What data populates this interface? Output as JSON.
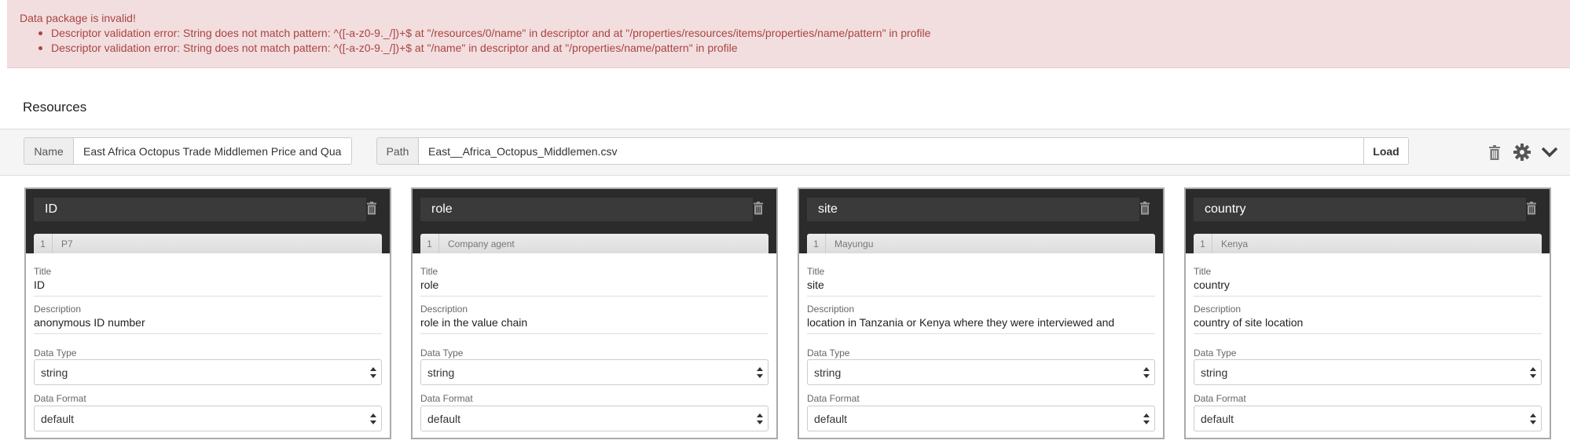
{
  "alert": {
    "title": "Data package is invalid!",
    "errors": [
      "Descriptor validation error: String does not match pattern: ^([-a-z0-9._/])+$ at \"/resources/0/name\" in descriptor and at \"/properties/resources/items/properties/name/pattern\" in profile",
      "Descriptor validation error: String does not match pattern: ^([-a-z0-9._/])+$ at \"/name\" in descriptor and at \"/properties/name/pattern\" in profile"
    ],
    "colors": {
      "background": "#f2dede",
      "text": "#a94442"
    }
  },
  "section_title": "Resources",
  "resource": {
    "name_label": "Name",
    "name_value": "East Africa Octopus Trade Middlemen Price and Qua",
    "path_label": "Path",
    "path_value": "East__Africa_Octopus_Middlemen.csv",
    "load_label": "Load",
    "icons": [
      "trash-icon",
      "gear-icon",
      "chevron-down-icon"
    ]
  },
  "labels": {
    "title": "Title",
    "description": "Description",
    "data_type": "Data Type",
    "data_format": "Data Format"
  },
  "fields": [
    {
      "name": "ID",
      "preview_row": "1",
      "preview_value": "P7",
      "title": "ID",
      "description": "anonymous ID number",
      "data_type": "string",
      "data_format": "default"
    },
    {
      "name": "role",
      "preview_row": "1",
      "preview_value": "Company agent",
      "title": "role",
      "description": "role in the value chain",
      "data_type": "string",
      "data_format": "default"
    },
    {
      "name": "site",
      "preview_row": "1",
      "preview_value": "Mayungu",
      "title": "site",
      "description": "location in Tanzania or Kenya where they were interviewed and",
      "data_type": "string",
      "data_format": "default"
    },
    {
      "name": "country",
      "preview_row": "1",
      "preview_value": "Kenya",
      "title": "country",
      "description": "country of site location",
      "data_type": "string",
      "data_format": "default"
    }
  ]
}
